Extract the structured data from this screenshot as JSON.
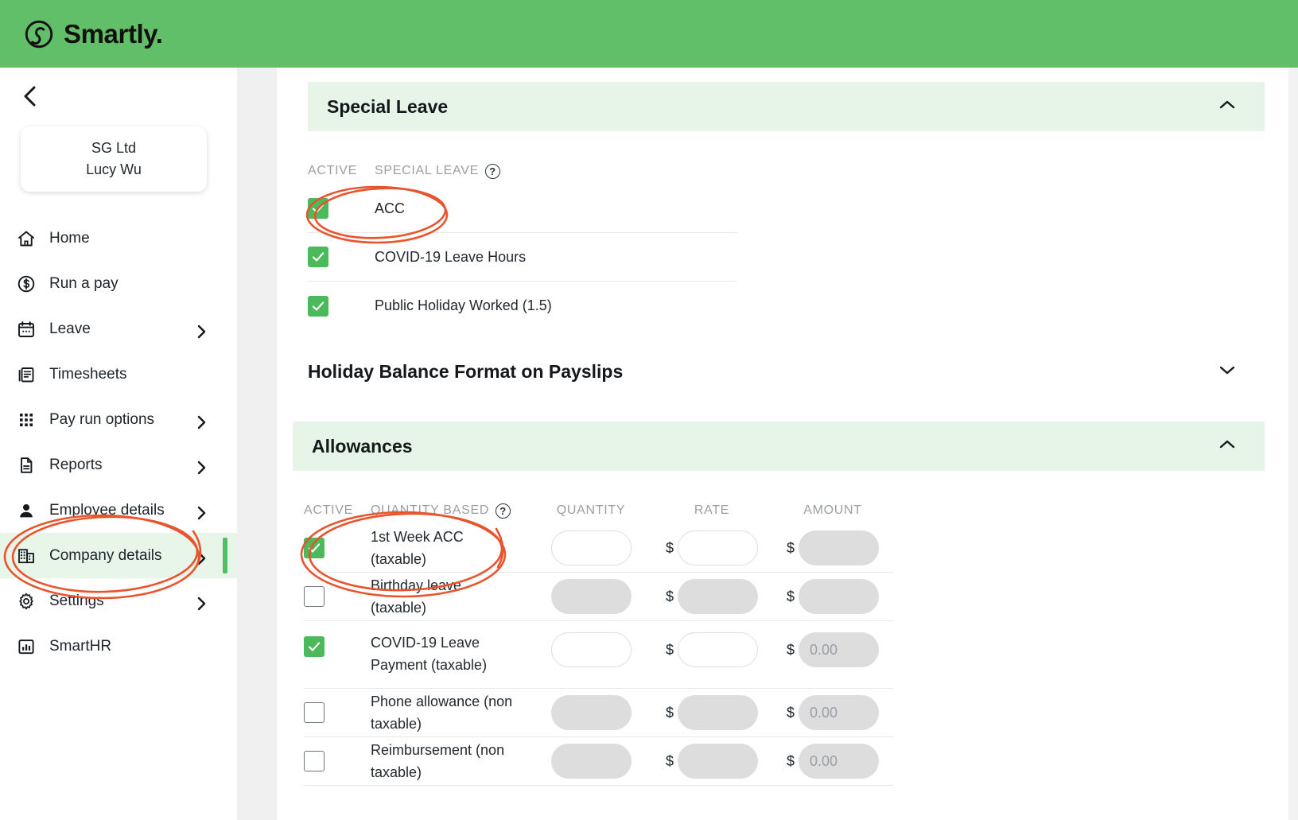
{
  "app": {
    "brand": "Smartly.",
    "brand_icon": "smartly-logo-icon",
    "header_color": "#62bf69",
    "accent_color": "#4cb95a",
    "panel_header_color": "#e6f5e7",
    "annotation_color": "#e8552d"
  },
  "sidebar": {
    "collapse_icon": "chevron-left-icon",
    "user_card": {
      "org": "SG Ltd",
      "name": "Lucy Wu"
    },
    "items": [
      {
        "label": "Home",
        "icon": "home-icon",
        "expandable": false,
        "active": false
      },
      {
        "label": "Run a pay",
        "icon": "dollar-coin-icon",
        "expandable": false,
        "active": false
      },
      {
        "label": "Leave",
        "icon": "calendar-icon",
        "expandable": true,
        "active": false
      },
      {
        "label": "Timesheets",
        "icon": "documents-icon",
        "expandable": false,
        "active": false
      },
      {
        "label": "Pay run options",
        "icon": "grid-dots-icon",
        "expandable": true,
        "active": false
      },
      {
        "label": "Reports",
        "icon": "file-lines-icon",
        "expandable": true,
        "active": false
      },
      {
        "label": "Employee details",
        "icon": "person-icon",
        "expandable": true,
        "active": false
      },
      {
        "label": "Company details",
        "icon": "building-icon",
        "expandable": true,
        "active": true
      },
      {
        "label": "Settings",
        "icon": "gear-icon",
        "expandable": true,
        "active": false
      },
      {
        "label": "SmartHR",
        "icon": "bar-chart-icon",
        "expandable": false,
        "active": false
      }
    ]
  },
  "special_leave": {
    "title": "Special Leave",
    "collapse_icon": "chevron-up-icon",
    "columns": {
      "active": "ACTIVE",
      "name": "SPECIAL LEAVE",
      "help_icon": "question-mark-icon"
    },
    "rows": [
      {
        "label": "ACC",
        "checked": true
      },
      {
        "label": "COVID-19 Leave Hours",
        "checked": true
      },
      {
        "label": "Public Holiday Worked (1.5)",
        "checked": true
      }
    ]
  },
  "holiday_balance": {
    "title": "Holiday Balance Format on Payslips",
    "expand_icon": "chevron-down-icon"
  },
  "allowances": {
    "title": "Allowances",
    "collapse_icon": "chevron-up-icon",
    "columns": {
      "active": "ACTIVE",
      "name": "QUANTITY BASED",
      "help_icon": "question-mark-icon",
      "quantity": "QUANTITY",
      "rate": "RATE",
      "amount": "AMOUNT"
    },
    "currency_symbol": "$",
    "rows": [
      {
        "label": "1st Week ACC (taxable)",
        "checked": true,
        "quantity": "",
        "rate": "",
        "amount": "",
        "quantity_locked": false,
        "rate_locked": false,
        "amount_locked": true
      },
      {
        "label": "Birthday leave (taxable)",
        "checked": false,
        "quantity": "",
        "rate": "",
        "amount": "",
        "quantity_locked": true,
        "rate_locked": true,
        "amount_locked": true
      },
      {
        "label": "COVID-19 Leave Payment (taxable)",
        "checked": true,
        "quantity": "",
        "rate": "",
        "amount": "0.00",
        "quantity_locked": false,
        "rate_locked": false,
        "amount_locked": true
      },
      {
        "label": "Phone allowance (non taxable)",
        "checked": false,
        "quantity": "",
        "rate": "",
        "amount": "0.00",
        "quantity_locked": true,
        "rate_locked": true,
        "amount_locked": true
      },
      {
        "label": "Reimbursement (non taxable)",
        "checked": false,
        "quantity": "",
        "rate": "",
        "amount": "0.00",
        "quantity_locked": true,
        "rate_locked": true,
        "amount_locked": true
      }
    ]
  },
  "annotations": [
    {
      "target": "acc-special-leave-row",
      "shape": "ellipse"
    },
    {
      "target": "company-details-nav-item",
      "shape": "ellipse"
    },
    {
      "target": "first-week-acc-row",
      "shape": "ellipse"
    }
  ]
}
